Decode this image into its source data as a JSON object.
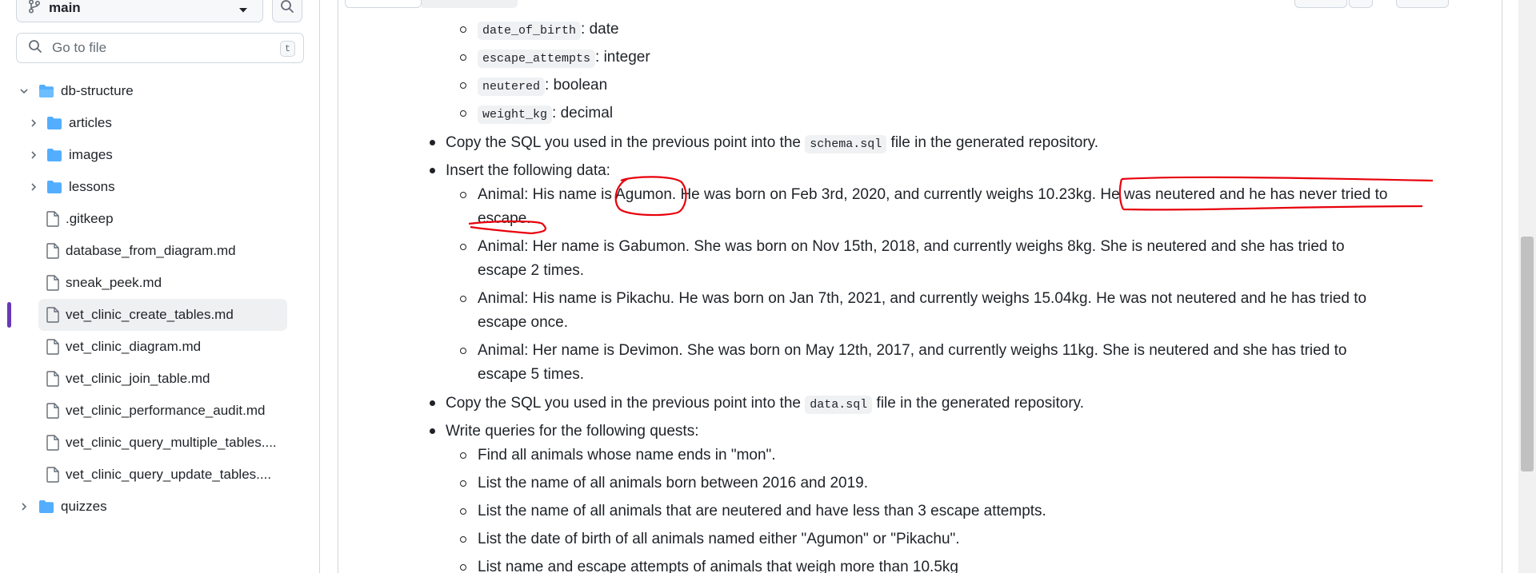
{
  "sidebar": {
    "branch": "main",
    "goto_placeholder": "Go to file",
    "goto_shortcut": "t",
    "items": [
      {
        "label": "db-structure",
        "type": "folder",
        "expanded": true
      },
      {
        "label": "articles",
        "type": "folder"
      },
      {
        "label": "images",
        "type": "folder"
      },
      {
        "label": "lessons",
        "type": "folder"
      },
      {
        "label": ".gitkeep",
        "type": "file"
      },
      {
        "label": "database_from_diagram.md",
        "type": "file"
      },
      {
        "label": "sneak_peek.md",
        "type": "file"
      },
      {
        "label": "vet_clinic_create_tables.md",
        "type": "file",
        "selected": true
      },
      {
        "label": "vet_clinic_diagram.md",
        "type": "file"
      },
      {
        "label": "vet_clinic_join_table.md",
        "type": "file"
      },
      {
        "label": "vet_clinic_performance_audit.md",
        "type": "file"
      },
      {
        "label": "vet_clinic_query_multiple_tables....",
        "type": "file"
      },
      {
        "label": "vet_clinic_query_update_tables....",
        "type": "file"
      },
      {
        "label": "quizzes",
        "type": "folder"
      }
    ]
  },
  "content": {
    "fields": [
      {
        "code": "date_of_birth",
        "type": ": date"
      },
      {
        "code": "escape_attempts",
        "type": ": integer"
      },
      {
        "code": "neutered",
        "type": ": boolean"
      },
      {
        "code": "weight_kg",
        "type": ": decimal"
      }
    ],
    "copy_schema": {
      "before": "Copy the SQL you used in the previous point into the",
      "code": "schema.sql",
      "after": "file in the generated repository."
    },
    "insert_heading": "Insert the following data:",
    "animals": [
      {
        "line1": "Animal: His name is Agumon. He was born on Feb 3rd, 2020, and currently weighs 10.23kg. He was neutered and he has never tried to",
        "line2": "escape."
      },
      {
        "line1": "Animal: Her name is Gabumon. She was born on Nov 15th, 2018, and currently weighs 8kg. She is neutered and she has tried to",
        "line2": "escape 2 times."
      },
      {
        "line1": "Animal: His name is Pikachu. He was born on Jan 7th, 2021, and currently weighs 15.04kg. He was not neutered and he has tried to",
        "line2": "escape once."
      },
      {
        "line1": "Animal: Her name is Devimon. She was born on May 12th, 2017, and currently weighs 11kg. She is neutered and she has tried to",
        "line2": "escape 5 times."
      }
    ],
    "copy_data": {
      "before": "Copy the SQL you used in the previous point into the",
      "code": "data.sql",
      "after": "file in the generated repository."
    },
    "queries_heading": "Write queries for the following quests:",
    "queries": [
      "Find all animals whose name ends in \"mon\".",
      "List the name of all animals born between 2016 and 2019.",
      "List the name of all animals that are neutered and have less than 3 escape attempts.",
      "List the date of birth of all animals named either \"Agumon\" or \"Pikachu\".",
      "List name and escape attempts of animals that weigh more than 10.5kg"
    ]
  },
  "colors": {
    "accent": "#6639ba",
    "folder": "#54aeff",
    "annotation": "#e8000b"
  }
}
